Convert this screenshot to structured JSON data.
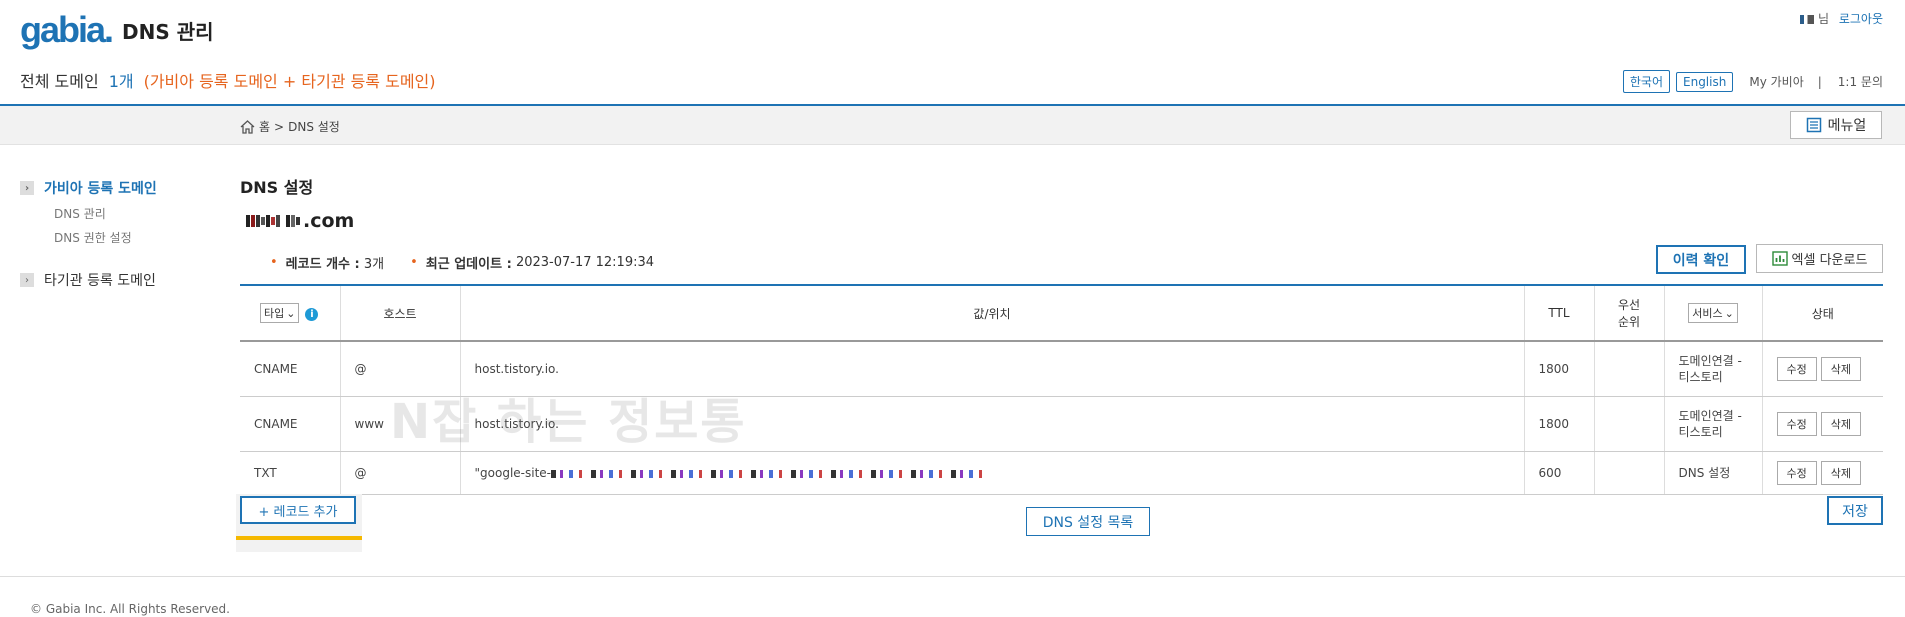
{
  "header": {
    "logo": "gabia.",
    "title": "DNS 관리",
    "user_suffix": "님",
    "logout": "로그아웃",
    "summary_label": "전체 도메인",
    "summary_count": "1개",
    "summary_note": "(가비아 등록 도메인 + 타기관 등록 도메인)",
    "lang_ko": "한국어",
    "lang_en": "English",
    "my_gabia": "My 가비아",
    "divider": "|",
    "inquiry": "1:1 문의"
  },
  "breadcrumb": {
    "home": "홈",
    "sep": ">",
    "current": "DNS 설정"
  },
  "manual_button": "메뉴얼",
  "sidebar": {
    "group1": "가비아 등록 도메인",
    "group1_items": [
      "DNS 관리",
      "DNS 권한 설정"
    ],
    "group2": "타기관 등록 도메인"
  },
  "main": {
    "title": "DNS 설정",
    "domain_suffix": ".com",
    "record_count_label": "레코드 개수 :",
    "record_count": "3개",
    "last_update_label": "최근 업데이트 :",
    "last_update": "2023-07-17 12:19:34",
    "history_button": "이력 확인",
    "excel_button": "엑셀 다운로드"
  },
  "table": {
    "headers": {
      "type": "타입",
      "host": "호스트",
      "value": "값/위치",
      "ttl": "TTL",
      "priority_line1": "우선",
      "priority_line2": "순위",
      "service": "서비스",
      "status": "상태"
    },
    "rows": [
      {
        "type": "CNAME",
        "host": "@",
        "value": "host.tistory.io.",
        "ttl": "1800",
        "priority": "",
        "service_line1": "도메인연결 -",
        "service_line2": "티스토리",
        "edit": "수정",
        "delete": "삭제"
      },
      {
        "type": "CNAME",
        "host": "www",
        "value": "host.tistory.io.",
        "ttl": "1800",
        "priority": "",
        "service_line1": "도메인연결 -",
        "service_line2": "티스토리",
        "edit": "수정",
        "delete": "삭제"
      },
      {
        "type": "TXT",
        "host": "@",
        "value": "\"google-site-",
        "ttl": "600",
        "priority": "",
        "service_line1": "DNS 설정",
        "service_line2": "",
        "edit": "수정",
        "delete": "삭제"
      }
    ],
    "watermark": "N잡 하는 정보통"
  },
  "bottom": {
    "add_record": "+ 레코드 추가",
    "dns_list": "DNS 설정 목록",
    "save": "저장"
  },
  "footer": "© Gabia Inc. All Rights Reserved.",
  "colors": {
    "accent": "#1e73b4",
    "orange": "#e6641e",
    "highlight": "#f5b800"
  }
}
